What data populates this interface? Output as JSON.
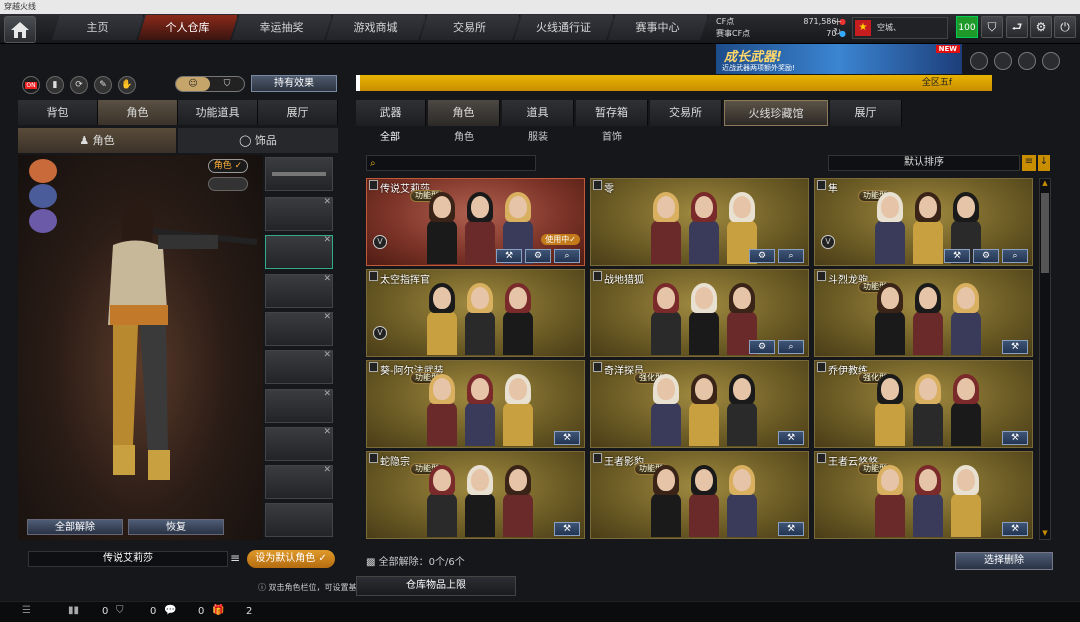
{
  "window": {
    "title": "穿越火线"
  },
  "nav": {
    "tabs": [
      {
        "label": "主页"
      },
      {
        "label": "个人仓库"
      },
      {
        "label": "幸运抽奖"
      },
      {
        "label": "游戏商城"
      },
      {
        "label": "交易所"
      },
      {
        "label": "火线通行证"
      },
      {
        "label": "赛事中心"
      }
    ],
    "active": "个人仓库"
  },
  "currency": {
    "cf_label": "CF点",
    "cf_value": "871,586",
    "match_label": "赛事CF点",
    "match_value": "70"
  },
  "user": {
    "name": "空城、",
    "level": "100"
  },
  "banner": {
    "title": "成长武器!",
    "subtitle": "近战武器两项额外奖励!",
    "badge": "NEW"
  },
  "marquee": {
    "text": "全区五f"
  },
  "left": {
    "toggle": {
      "on_label": "ON"
    },
    "effect_button": "持有效果",
    "tabs": [
      "背包",
      "角色",
      "功能道具",
      "展厅"
    ],
    "subtabs": [
      "角色",
      "饰品"
    ],
    "role_badge": "角色 ✓",
    "btn_unequip": "全部解除",
    "btn_restore": "恢复",
    "char_name": "传说艾莉莎",
    "set_default": "设为默认角色 ✓",
    "tip": "双击角色栏位，可设置基本角色。"
  },
  "right": {
    "tabs": [
      "武器",
      "角色",
      "道具",
      "暂存箱",
      "交易所",
      "火线珍藏馆",
      "展厅"
    ],
    "subtabs": [
      "全部",
      "角色",
      "服装",
      "首饰"
    ],
    "sort_label": "默认排序",
    "cards": [
      {
        "name": "传说艾莉莎",
        "tag": "功能型",
        "inuse": "使用中✓"
      },
      {
        "name": "零",
        "tag": ""
      },
      {
        "name": "隼",
        "tag": "功能型"
      },
      {
        "name": "太空指挥官",
        "tag": ""
      },
      {
        "name": "战地猎狐",
        "tag": ""
      },
      {
        "name": "斗烈龙驹",
        "tag": "功能型"
      },
      {
        "name": "葵-阿尔法武装",
        "tag": "功能型"
      },
      {
        "name": "奇洋探员",
        "tag": "强化型"
      },
      {
        "name": "乔伊教练",
        "tag": "强化型"
      },
      {
        "name": "蛇隐宗",
        "tag": "功能型"
      },
      {
        "name": "王者影豹",
        "tag": "功能型"
      },
      {
        "name": "王者云悠悠",
        "tag": "功能型"
      }
    ],
    "clear_label": "全部解除：",
    "clear_count": "0个/6个",
    "select_delete": "选择删除"
  },
  "capacity": {
    "label": "仓库物品上限"
  },
  "bottom": {
    "counts": [
      "0",
      "0",
      "0",
      "2"
    ]
  },
  "colors": {
    "accent": "#c98d00",
    "active_tab": "#8a2a1a",
    "card_gold": "#6a5a24",
    "card_selected": "#7a3226"
  }
}
